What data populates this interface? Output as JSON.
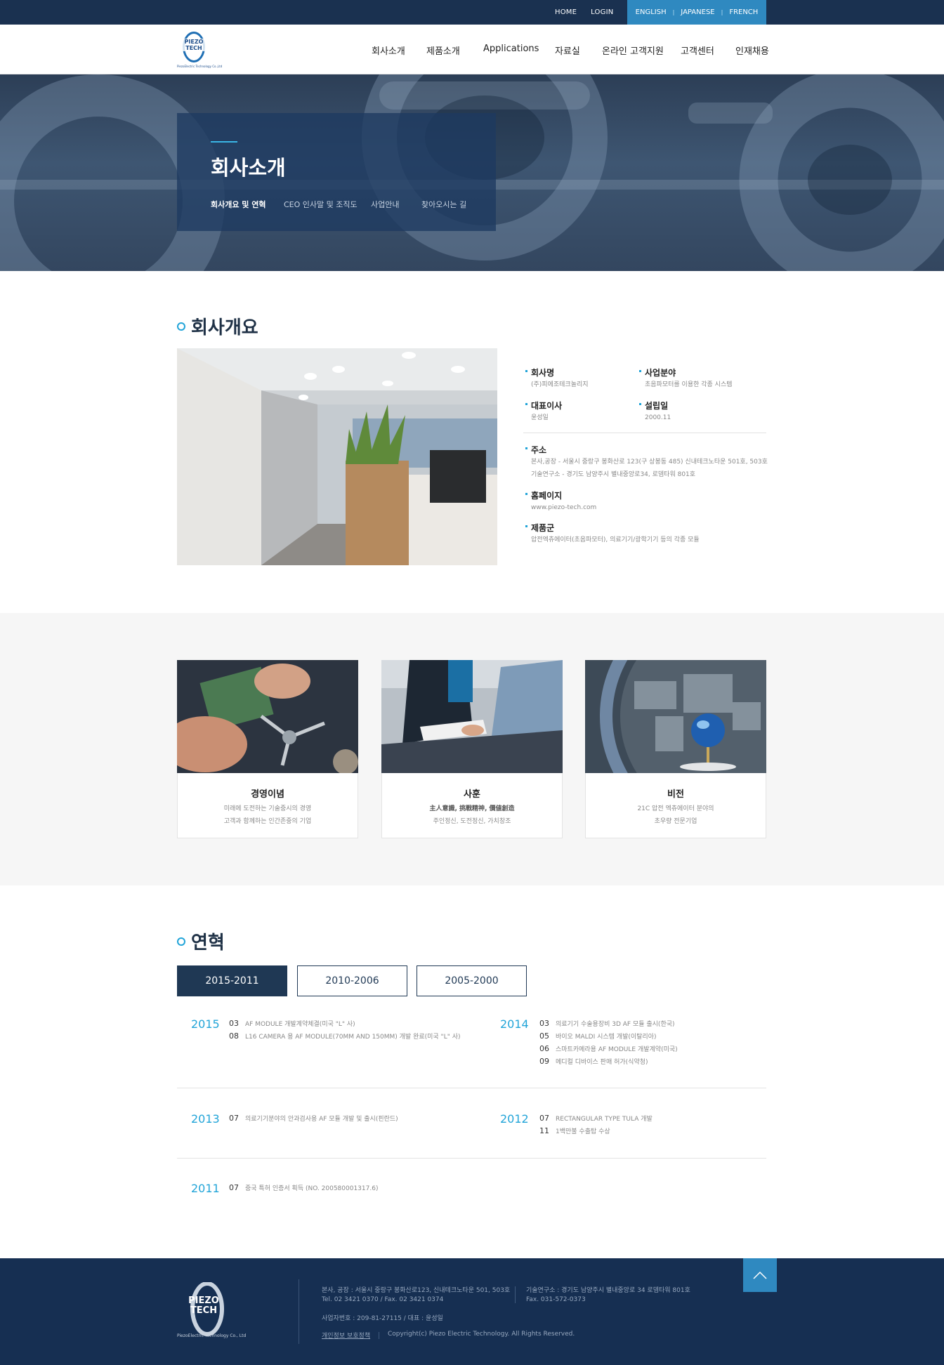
{
  "topbar": {
    "links": [
      "HOME",
      "LOGIN"
    ],
    "languages": [
      "ENGLISH",
      "JAPANESE",
      "FRENCH"
    ]
  },
  "logo": {
    "text_line1": "PIEZO",
    "text_line2": "TECH",
    "subtitle": "PiezoElectric Technology Co.,Ltd"
  },
  "nav": [
    "회사소개",
    "제품소개",
    "Applications",
    "자료실",
    "온라인 고객지원",
    "고객센터",
    "인재채용"
  ],
  "hero": {
    "title": "회사소개",
    "tabs": [
      "회사개요 및 연혁",
      "CEO 인사말 및 조직도",
      "사업안내",
      "찾아오시는 길"
    ]
  },
  "overview": {
    "heading": "회사개요",
    "fields": {
      "company_label": "회사명",
      "company_value": "(주)피에조테크놀리지",
      "business_label": "사업분야",
      "business_value": "초음파모터를 이용한 각종 시스템",
      "ceo_label": "대표이사",
      "ceo_value": "윤성일",
      "founded_label": "설립일",
      "founded_value": "2000.11",
      "address_label": "주소",
      "address_line1": "본사,공장 - 서울시 중랑구 봉화산로 123(구 상봉동 485) 신내테크노타운 501호, 503호",
      "address_line2": "기술연구소 - 경기도 남양주시 별내중앙로34, 로뎀타워 801호",
      "homepage_label": "홈페이지",
      "homepage_value": "www.piezo-tech.com",
      "products_label": "제품군",
      "products_value": "압전엑츄에이터(초음파모터), 의료기기/광학기기 등의 각종 모듈"
    }
  },
  "cards": [
    {
      "title": "경영이념",
      "line1": "미래에 도전하는 기술중시의 경영",
      "line2": "고객과 함께하는 인간존중의 기업"
    },
    {
      "title": "사훈",
      "line1": "主人意識, 挑戰精神, 價値創造",
      "line2": "주인정신, 도전정신, 가치창조"
    },
    {
      "title": "비전",
      "line1": "21C 압전 엑츄에이터 분야의",
      "line2": "초우량 전문기업"
    }
  ],
  "history": {
    "heading": "연혁",
    "tabs": [
      "2015-2011",
      "2010-2006",
      "2005-2000"
    ],
    "years": [
      {
        "year": "2015",
        "items": [
          {
            "m": "03",
            "t": "AF MODULE 개발계약체결(미국 \"L\" 사)"
          },
          {
            "m": "08",
            "t": "L16 CAMERA 용 AF MODULE(70MM AND 150MM) 개발 완료(미국 \"L\" 사)"
          }
        ]
      },
      {
        "year": "2014",
        "items": [
          {
            "m": "03",
            "t": "의료기기 수술용장비 3D AF 모듈 출시(한국)"
          },
          {
            "m": "05",
            "t": "바이오 MALDI 시스템 개발(이탈리아)"
          },
          {
            "m": "06",
            "t": "스마트카메라용 AF MODULE 개발계약(미국)"
          },
          {
            "m": "09",
            "t": "메디컬 디바이스 판매 허가(식약청)"
          }
        ]
      },
      {
        "year": "2013",
        "items": [
          {
            "m": "07",
            "t": "의료기기분야의 안과검사용 AF 모듈 개발 및 출시(핀란드)"
          }
        ]
      },
      {
        "year": "2012",
        "items": [
          {
            "m": "07",
            "t": "RECTANGULAR TYPE TULA 개발"
          },
          {
            "m": "11",
            "t": "1백만불 수출탑 수상"
          }
        ]
      },
      {
        "year": "2011",
        "items": [
          {
            "m": "07",
            "t": "중국 특허 인증서 획득 (NO. 200580001317.6)"
          }
        ]
      }
    ]
  },
  "footer": {
    "hq_line1": "본사, 공장 : 서울시 중랑구 봉화산로123, 신내테크노타운 501, 503호",
    "hq_line2": "Tel. 02 3421 0370  /  Fax. 02 3421 0374",
    "lab_line1": "기술연구소 : 경기도 남양주시 별내중앙로 34 로뎀타워 801호",
    "lab_line2": "Fax. 031-572-0373",
    "biz_line": "사업자번호 : 209-81-27115  /  대표 : 윤성일",
    "privacy": "개인정보 보호정책",
    "copyright": "Copyright(c) Piezo Electric Technology. All Rights Reserved.",
    "logo_line1": "PIEZO",
    "logo_line2": "TECH",
    "logo_sub": "PiezoElectric Technology Co., Ltd"
  },
  "colors": {
    "navy": "#1a3150",
    "accent": "#2f89c0",
    "cyan": "#21a4d8",
    "footer": "#162f52"
  }
}
